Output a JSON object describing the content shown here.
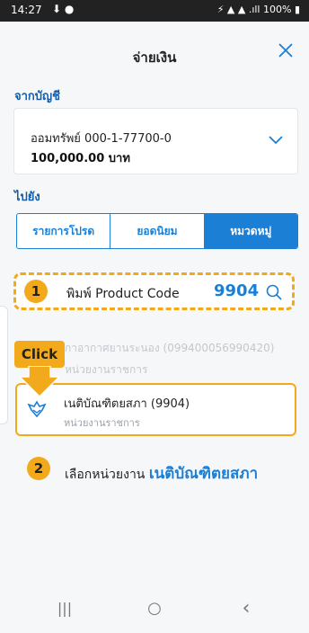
{
  "status_bar": {
    "time": "14:27",
    "left_icons": "⬇ ●",
    "right_text": "100%"
  },
  "header": {
    "title": "จ่ายเงิน",
    "close_icon": "close-icon"
  },
  "from_section": {
    "label": "จากบัญชี",
    "account_name": "ออมทรัพย์ 000-1-77700-0",
    "balance": "100,000.00 บาท"
  },
  "to_section": {
    "label": "ไปยัง"
  },
  "tabs": [
    {
      "label": "รายการโปรด",
      "active": false
    },
    {
      "label": "ยอดนิยม",
      "active": false
    },
    {
      "label": "หมวดหมู่",
      "active": true
    }
  ],
  "search": {
    "step": "1",
    "text": "พิมพ์ Product Code",
    "code": "9904"
  },
  "faded_result": {
    "line1": "กาอากาศยานระนอง (099400056990420)",
    "line2": "หน่วยงานราชการ"
  },
  "callout": {
    "label": "Click"
  },
  "result": {
    "name": "เนติบัณฑิตยสภา (9904)",
    "category": "หน่วยงานราชการ"
  },
  "step2": {
    "step": "2",
    "text": "เลือกหน่วยงาน",
    "highlight": "เนติบัณฑิตยสภา"
  },
  "nav": {
    "recent": "|||",
    "home": "○",
    "back": "‹"
  },
  "colors": {
    "accent": "#1b7fd6",
    "highlight": "#f2aa1c",
    "section_label": "#135ea8"
  }
}
